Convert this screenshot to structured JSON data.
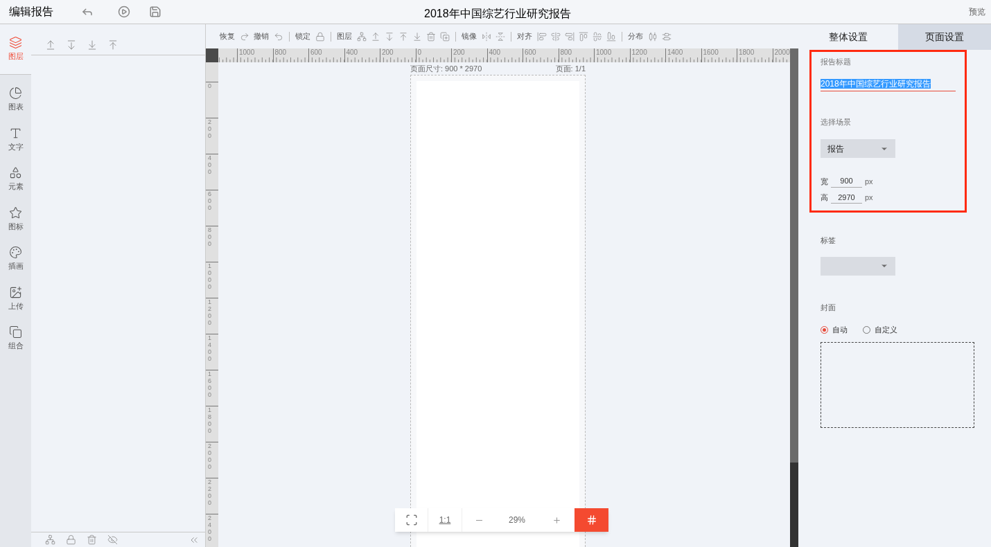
{
  "header": {
    "app_title": "编辑报告",
    "document_title": "2018年中国综艺行业研究报告",
    "preview": "预览"
  },
  "sidebar": {
    "items": [
      {
        "label": "图层",
        "selected": true
      },
      {
        "label": "图表",
        "selected": false
      },
      {
        "label": "文字",
        "selected": false
      },
      {
        "label": "元素",
        "selected": false
      },
      {
        "label": "图标",
        "selected": false
      },
      {
        "label": "插画",
        "selected": false
      },
      {
        "label": "上传",
        "selected": false
      },
      {
        "label": "组合",
        "selected": false
      }
    ]
  },
  "toolbar": {
    "groups": [
      {
        "label": "恢复"
      },
      {
        "label": "撤销"
      },
      {
        "label": "锁定"
      },
      {
        "label": "图层"
      },
      {
        "label": "镜像"
      },
      {
        "label": "对齐"
      },
      {
        "label": "分布"
      }
    ]
  },
  "ruler": {
    "top_labels": [
      "1000",
      "800",
      "600",
      "400",
      "200",
      "0",
      "200",
      "400",
      "600",
      "800",
      "1000",
      "1200",
      "1400",
      "1600",
      "1800",
      "2000"
    ],
    "left_labels": [
      "0",
      "200",
      "400",
      "600",
      "800",
      "1000",
      "1200",
      "1400",
      "1600",
      "1800",
      "2000",
      "2200",
      "2400"
    ]
  },
  "canvas": {
    "page_size": "页面尺寸: 900 * 2970",
    "page_number": "页面: 1/1"
  },
  "zoom_bar": {
    "fit_label": "1:1",
    "zoom": "29%",
    "grid_on": true
  },
  "right_panel": {
    "tabs": [
      {
        "label": "整体设置",
        "selected": false
      },
      {
        "label": "页面设置",
        "selected": true
      }
    ],
    "title_label": "报告标题",
    "title_value": "2018年中国综艺行业研究报告",
    "scene_label": "选择场景",
    "scene_value": "报告",
    "width_label": "宽",
    "width_value": "900",
    "height_label": "高",
    "height_value": "2970",
    "unit_width": "px",
    "unit_height": "px",
    "tag_label": "标签",
    "cover_label": "封面",
    "cover_options": [
      {
        "label": "自动",
        "selected": true
      },
      {
        "label": "自定义",
        "selected": false
      }
    ]
  }
}
